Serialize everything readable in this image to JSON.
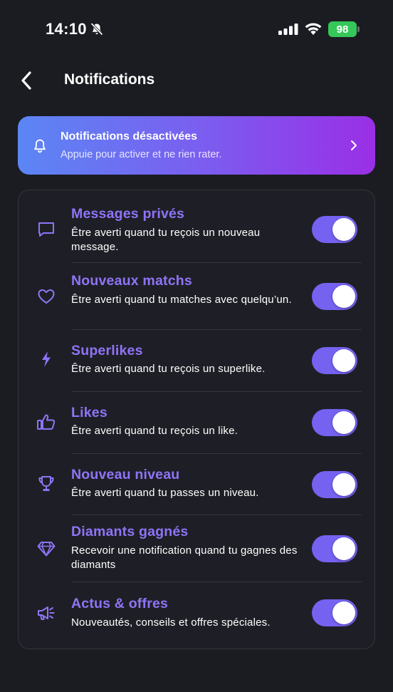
{
  "status_bar": {
    "time": "14:10",
    "battery": "98"
  },
  "header": {
    "back_icon": "chevron-left-icon",
    "title": "Notifications"
  },
  "banner": {
    "icon": "bell-icon",
    "title": "Notifications désactivées",
    "subtitle": "Appuie pour activer et ne rien rater.",
    "gradient": [
      "#5b86f4",
      "#7a5ff0",
      "#9a2fe6"
    ]
  },
  "colors": {
    "accent": "#8f74f7",
    "toggle_on": "#7562f1",
    "background": "#1b1c22"
  },
  "settings": [
    {
      "icon": "message-icon",
      "title": "Messages privés",
      "description": "Être averti quand tu reçois un nouveau message.",
      "enabled": true
    },
    {
      "icon": "heart-icon",
      "title": "Nouveaux matchs",
      "description": "Être averti quand tu matches avec quelqu’un.",
      "enabled": true
    },
    {
      "icon": "bolt-icon",
      "title": "Superlikes",
      "description": "Être averti quand tu reçois un superlike.",
      "enabled": true
    },
    {
      "icon": "thumbs-up-icon",
      "title": "Likes",
      "description": "Être averti quand tu reçois un like.",
      "enabled": true
    },
    {
      "icon": "trophy-icon",
      "title": "Nouveau niveau",
      "description": "Être averti quand tu passes un niveau.",
      "enabled": true
    },
    {
      "icon": "diamond-icon",
      "title": "Diamants gagnés",
      "description": "Recevoir une notification quand tu gagnes des diamants",
      "enabled": true
    },
    {
      "icon": "megaphone-icon",
      "title": "Actus & offres",
      "description": "Nouveautés, conseils et offres spéciales.",
      "enabled": true
    }
  ]
}
